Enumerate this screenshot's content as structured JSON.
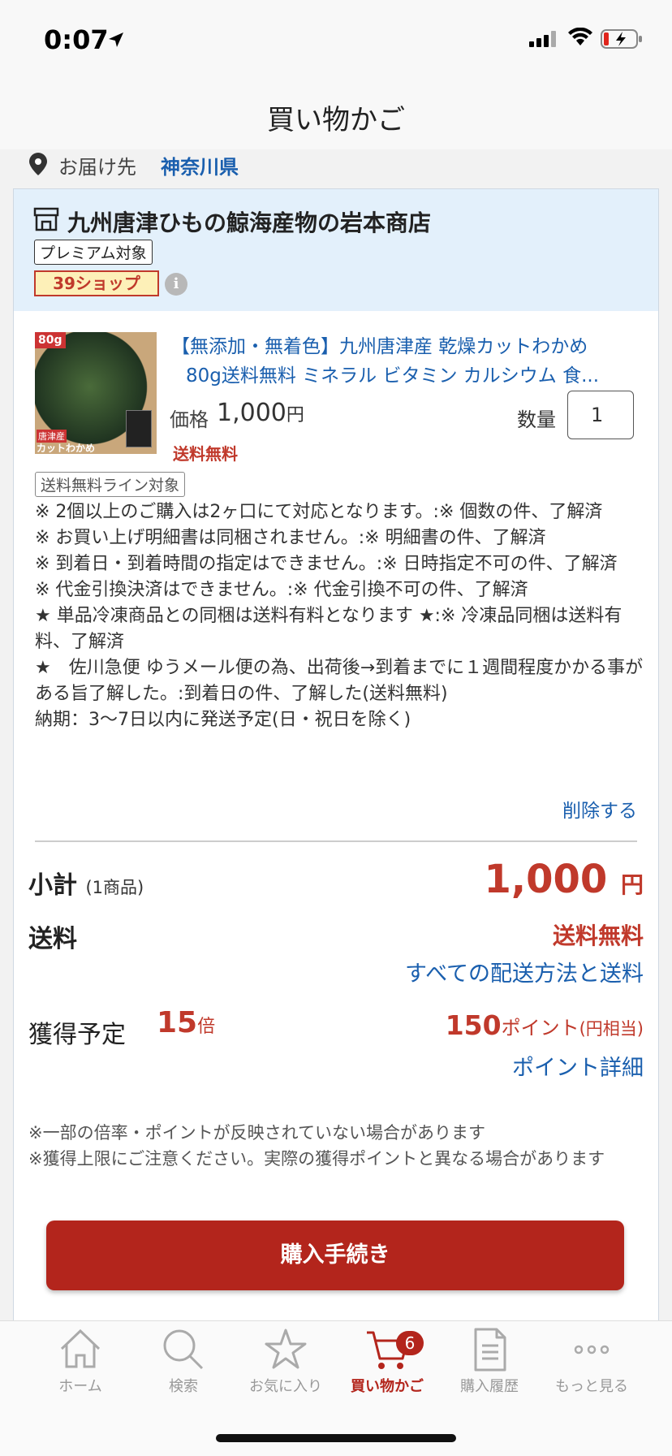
{
  "status_bar": {
    "time": "0:07"
  },
  "nav": {
    "title": "買い物かご"
  },
  "delivery": {
    "label": "お届け先",
    "value": "神奈川県"
  },
  "shop": {
    "name": "九州唐津ひもの鯨海産物の岩本商店",
    "badge_premium": "プレミアム対象",
    "badge_39": "39ショップ",
    "info_icon": "i"
  },
  "product": {
    "image_badge": "80g",
    "image_tag": "唐津産",
    "image_caption": "カットわかめ",
    "title_line1": "【無添加・無着色】九州唐津産 乾燥カットわかめ",
    "title_line2": "80g送料無料 ミネラル ビタミン カルシウム 食...",
    "price_label": "価格",
    "price_value": "1,000",
    "price_unit": "円",
    "free_shipping": "送料無料",
    "quantity_label": "数量",
    "quantity_value": "1"
  },
  "badge_shipping_line": "送料無料ライン対象",
  "notes": [
    "※ 2個以上のご購入は2ヶ口にて対応となります。:※ 個数の件、了解済",
    "※ お買い上げ明細書は同梱されません。:※ 明細書の件、了解済",
    "※ 到着日・到着時間の指定はできません。:※ 日時指定不可の件、了解済",
    "※ 代金引換決済はできません。:※ 代金引換不可の件、了解済",
    "★ 単品冷凍商品との同梱は送料有料となります ★:※ 冷凍品同梱は送料有料、了解済",
    "★　佐川急便 ゆうメール便の為、出荷後→到着までに１週間程度かかる事がある旨了解した。:到着日の件、了解した(送料無料)",
    "納期：3〜7日以内に発送予定(日・祝日を除く)"
  ],
  "delete_label": "削除する",
  "summary": {
    "subtotal_label": "小計",
    "subtotal_count": "(1商品)",
    "subtotal_value": "1,000",
    "subtotal_unit": "円",
    "shipping_label": "送料",
    "shipping_value": "送料無料",
    "shipping_methods_link": "すべての配送方法と送料",
    "earn_label": "獲得予定",
    "earn_multiplier": "15",
    "earn_multiplier_unit": "倍",
    "points_value": "150",
    "points_unit": "ポイント",
    "points_yen": "(円相当)",
    "points_detail_link": "ポイント詳細"
  },
  "disclaimer": [
    "※一部の倍率・ポイントが反映されていない場合があります",
    "※獲得上限にご注意ください。実際の獲得ポイントと異なる場合があります"
  ],
  "checkout_button": "購入手続き",
  "tabs": [
    {
      "label": "ホーム",
      "icon": "home-icon"
    },
    {
      "label": "検索",
      "icon": "search-icon"
    },
    {
      "label": "お気に入り",
      "icon": "star-icon"
    },
    {
      "label": "買い物かご",
      "icon": "cart-icon",
      "badge": "6",
      "active": true
    },
    {
      "label": "購入履歴",
      "icon": "history-icon"
    },
    {
      "label": "もっと見る",
      "icon": "more-icon"
    }
  ],
  "colors": {
    "accent_red": "#b3251c",
    "link_blue": "#1a5fae",
    "shop_header_bg": "#e3f0fb"
  }
}
